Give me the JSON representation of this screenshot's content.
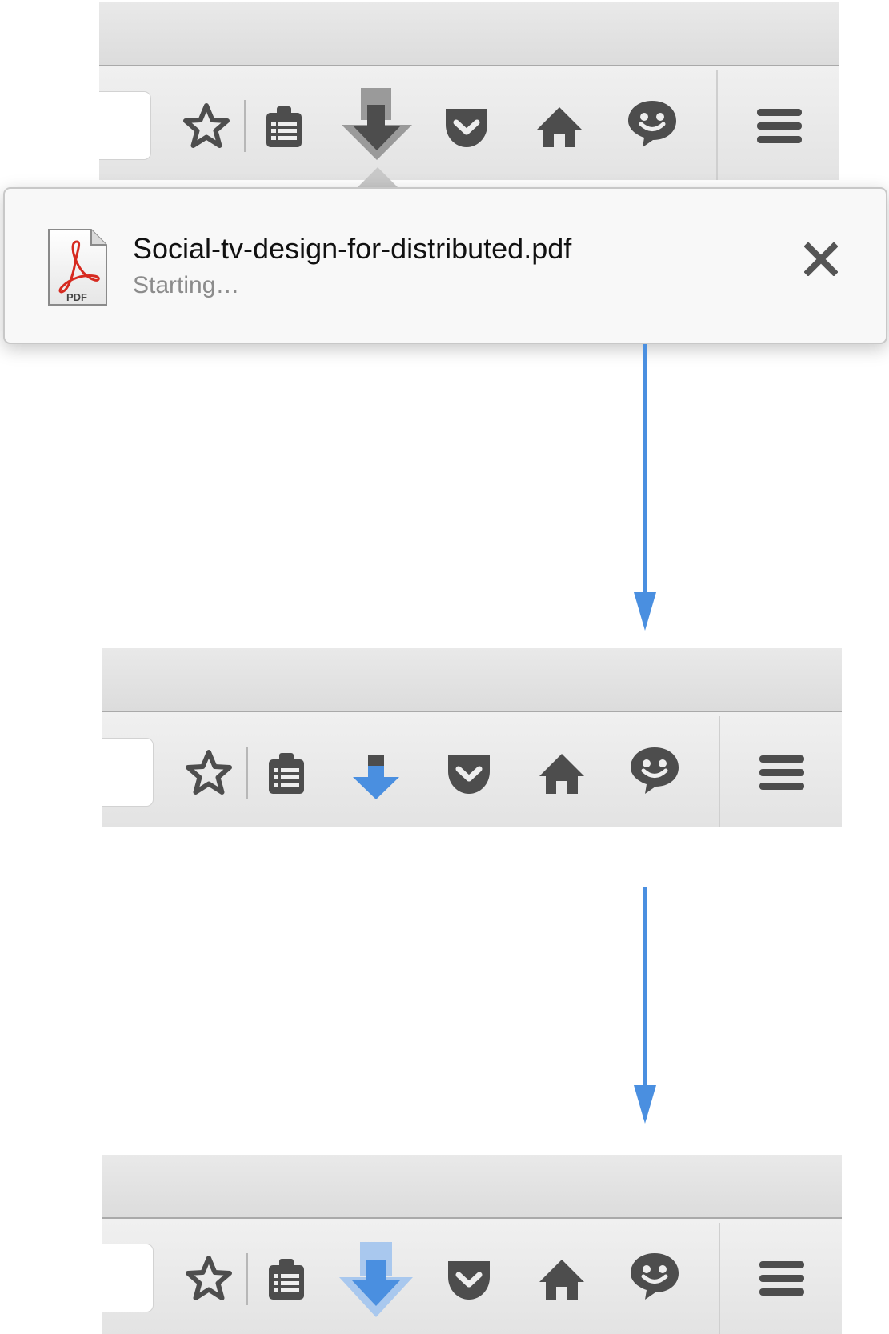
{
  "download_panel": {
    "file_name": "Social-tv-design-for-distributed.pdf",
    "status": "Starting…",
    "file_type_label": "PDF",
    "file_icon": "pdf-document-icon",
    "close_icon": "close-icon"
  },
  "toolbar_buttons": [
    {
      "name": "bookmark-star",
      "icon": "star-icon"
    },
    {
      "name": "bookmarks-menu",
      "icon": "clipboard-list-icon"
    },
    {
      "name": "downloads",
      "icon": "download-arrow-icon"
    },
    {
      "name": "pocket",
      "icon": "pocket-icon"
    },
    {
      "name": "home",
      "icon": "home-icon"
    },
    {
      "name": "social",
      "icon": "chat-smiley-icon"
    },
    {
      "name": "menu",
      "icon": "hamburger-menu-icon"
    }
  ],
  "states": [
    {
      "label": "downloads-button-active",
      "download_arrow_color": "#4d4d4d"
    },
    {
      "label": "downloads-button-started",
      "download_arrow_color": "#4a8fe0"
    },
    {
      "label": "downloads-button-animating",
      "download_arrow_color": "#4a8fe0"
    }
  ],
  "colors": {
    "accent": "#4a8fe0",
    "icon": "#4d4d4d",
    "pdf_red": "#d62a20"
  }
}
